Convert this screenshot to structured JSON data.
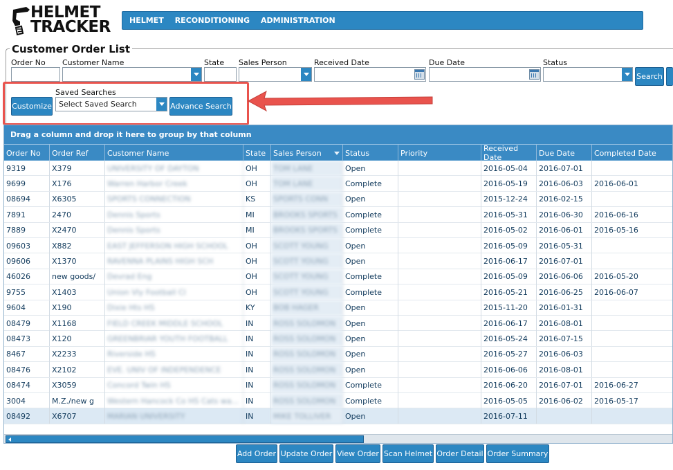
{
  "logo": {
    "line1": "HELMET",
    "line2": "TRACKER"
  },
  "nav": {
    "items": [
      "HELMET",
      "RECONDITIONING",
      "ADMINISTRATION"
    ]
  },
  "filters": {
    "title": "Customer Order List",
    "order_no_label": "Order No",
    "customer_name_label": "Customer Name",
    "state_label": "State",
    "sales_person_label": "Sales Person",
    "received_date_label": "Received Date",
    "due_date_label": "Due Date",
    "status_label": "Status",
    "search_button": "Search",
    "customize_button": "Customize",
    "saved_searches_label": "Saved Searches",
    "saved_searches_value": "Select Saved Search",
    "advance_search_button": "Advance Search"
  },
  "highlight_color": "#e9534d",
  "accent_color": "#2c87c2",
  "grid": {
    "group_hint": "Drag a column and drop it here to group by that column",
    "columns": [
      "Order No",
      "Order Ref",
      "Customer Name",
      "State",
      "Sales Person",
      "Status",
      "Priority",
      "Received Date",
      "Due Date",
      "Completed Date"
    ],
    "rows": [
      {
        "order_no": "9319",
        "order_ref": "X379",
        "customer": "UNIVERSITY OF DAYTON",
        "state": "OH",
        "sales": "TOM LANE",
        "status": "Open",
        "priority": "",
        "received": "2016-05-04",
        "due": "2016-07-01",
        "completed": ""
      },
      {
        "order_no": "9699",
        "order_ref": "X176",
        "customer": "Warren Harbor Creek",
        "state": "OH",
        "sales": "TOM LANE",
        "status": "Complete",
        "priority": "",
        "received": "2016-05-19",
        "due": "2016-06-03",
        "completed": "2016-06-01"
      },
      {
        "order_no": "08694",
        "order_ref": "X6305",
        "customer": "SPORTS CONNECTION",
        "state": "KS",
        "sales": "SPORTS CONN",
        "status": "Open",
        "priority": "",
        "received": "2015-12-24",
        "due": "2016-02-15",
        "completed": ""
      },
      {
        "order_no": "7891",
        "order_ref": "2470",
        "customer": "Dennis Sports",
        "state": "MI",
        "sales": "BROOKS SPORTS",
        "status": "Complete",
        "priority": "",
        "received": "2016-05-31",
        "due": "2016-06-30",
        "completed": "2016-06-16"
      },
      {
        "order_no": "7889",
        "order_ref": "X2470",
        "customer": "Dennis Sports",
        "state": "MI",
        "sales": "BROOKS SPORTS",
        "status": "Complete",
        "priority": "",
        "received": "2016-05-02",
        "due": "2016-06-01",
        "completed": "2016-05-16"
      },
      {
        "order_no": "09603",
        "order_ref": "X882",
        "customer": "EAST JEFFERSON HIGH SCHOOL",
        "state": "OH",
        "sales": "SCOTT YOUNG",
        "status": "Open",
        "priority": "",
        "received": "2016-05-09",
        "due": "2016-05-31",
        "completed": ""
      },
      {
        "order_no": "09606",
        "order_ref": "X1370",
        "customer": "RAVENNA PLAINS HIGH SCH",
        "state": "OH",
        "sales": "SCOTT YOUNG",
        "status": "Open",
        "priority": "",
        "received": "2016-06-17",
        "due": "2016-07-01",
        "completed": ""
      },
      {
        "order_no": "46026",
        "order_ref": "new goods/",
        "customer": "Devrad Eng",
        "state": "OH",
        "sales": "SCOTT YOUNG",
        "status": "Complete",
        "priority": "",
        "received": "2016-05-09",
        "due": "2016-06-06",
        "completed": "2016-05-20"
      },
      {
        "order_no": "9755",
        "order_ref": "X1403",
        "customer": "Union Vly Football Cl",
        "state": "OH",
        "sales": "SCOTT YOUNG",
        "status": "Complete",
        "priority": "",
        "received": "2016-05-21",
        "due": "2016-06-25",
        "completed": "2016-06-07"
      },
      {
        "order_no": "9604",
        "order_ref": "X190",
        "customer": "Dixie Hts HS",
        "state": "KY",
        "sales": "BOB HAGER",
        "status": "Open",
        "priority": "",
        "received": "2015-11-20",
        "due": "2016-01-31",
        "completed": ""
      },
      {
        "order_no": "08479",
        "order_ref": "X1168",
        "customer": "FIELD CREEK MIDDLE SCHOOL",
        "state": "IN",
        "sales": "ROSS SOLOMON",
        "status": "Open",
        "priority": "",
        "received": "2016-06-17",
        "due": "2016-08-01",
        "completed": ""
      },
      {
        "order_no": "08473",
        "order_ref": "X120",
        "customer": "GREENBRIAR YOUTH FOOTBALL",
        "state": "IN",
        "sales": "ROSS SOLOMON",
        "status": "Open",
        "priority": "",
        "received": "2016-05-24",
        "due": "2016-07-15",
        "completed": ""
      },
      {
        "order_no": "8467",
        "order_ref": "X2233",
        "customer": "Riverside HS",
        "state": "IN",
        "sales": "ROSS SOLOMON",
        "status": "Open",
        "priority": "",
        "received": "2016-05-27",
        "due": "2016-06-03",
        "completed": ""
      },
      {
        "order_no": "08476",
        "order_ref": "X2102",
        "customer": "EVE. UNIV OF INDEPENDENCE",
        "state": "IN",
        "sales": "ROSS SOLOMON",
        "status": "Open",
        "priority": "",
        "received": "2016-06-06",
        "due": "2016-08-01",
        "completed": ""
      },
      {
        "order_no": "08474",
        "order_ref": "X3059",
        "customer": "Concord Twin HS",
        "state": "IN",
        "sales": "ROSS SOLOMON",
        "status": "Complete",
        "priority": "",
        "received": "2016-06-20",
        "due": "2016-07-01",
        "completed": "2016-06-27"
      },
      {
        "order_no": "3004",
        "order_ref": "M.Z./new g",
        "customer": "Western Hancock Co HS Cats wa...",
        "state": "IN",
        "sales": "ROSS SOLOMON",
        "status": "Complete",
        "priority": "",
        "received": "2016-05-05",
        "due": "2016-06-02",
        "completed": "2016-05-17"
      },
      {
        "order_no": "08492",
        "order_ref": "X6707",
        "customer": "MARIAN UNIVERSITY",
        "state": "IN",
        "sales": "MIKE TOLLIVER",
        "status": "Open",
        "priority": "",
        "received": "2016-07-11",
        "due": "",
        "completed": ""
      }
    ]
  },
  "actions": [
    "Add Order",
    "Update Order",
    "View Order",
    "Scan Helmet",
    "Order Detail",
    "Order Summary"
  ]
}
